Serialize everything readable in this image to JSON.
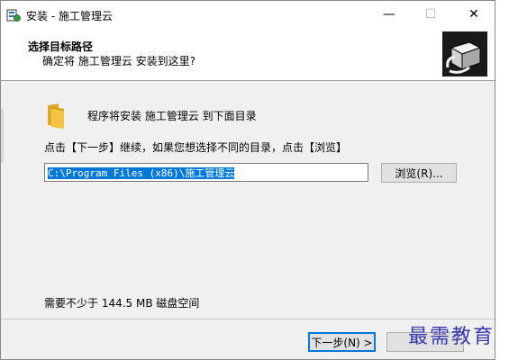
{
  "window": {
    "title": "安装 - 施工管理云",
    "minimize_glyph": "—",
    "maximize_glyph": "☐",
    "close_glyph": "✕"
  },
  "header": {
    "title": "选择目标路径",
    "subtitle": "确定将 施工管理云 安装到这里?"
  },
  "body": {
    "intro": "程序将安装 施工管理云 到下面目录",
    "instruction": "点击【下一步】继续，如果您想选择不同的目录，点击【浏览】",
    "path_value": "C:\\Program Files (x86)\\施工管理云",
    "browse_label": "浏览(R)...",
    "space_required": "需要不少于 144.5 MB 磁盘空间"
  },
  "footer": {
    "next_label": "下一步(N) >",
    "cancel_label": "取消"
  },
  "watermark": "最需教育",
  "colors": {
    "selection": "#0078d7",
    "folder": "#f5c342",
    "watermark": "#3a3aa8"
  }
}
